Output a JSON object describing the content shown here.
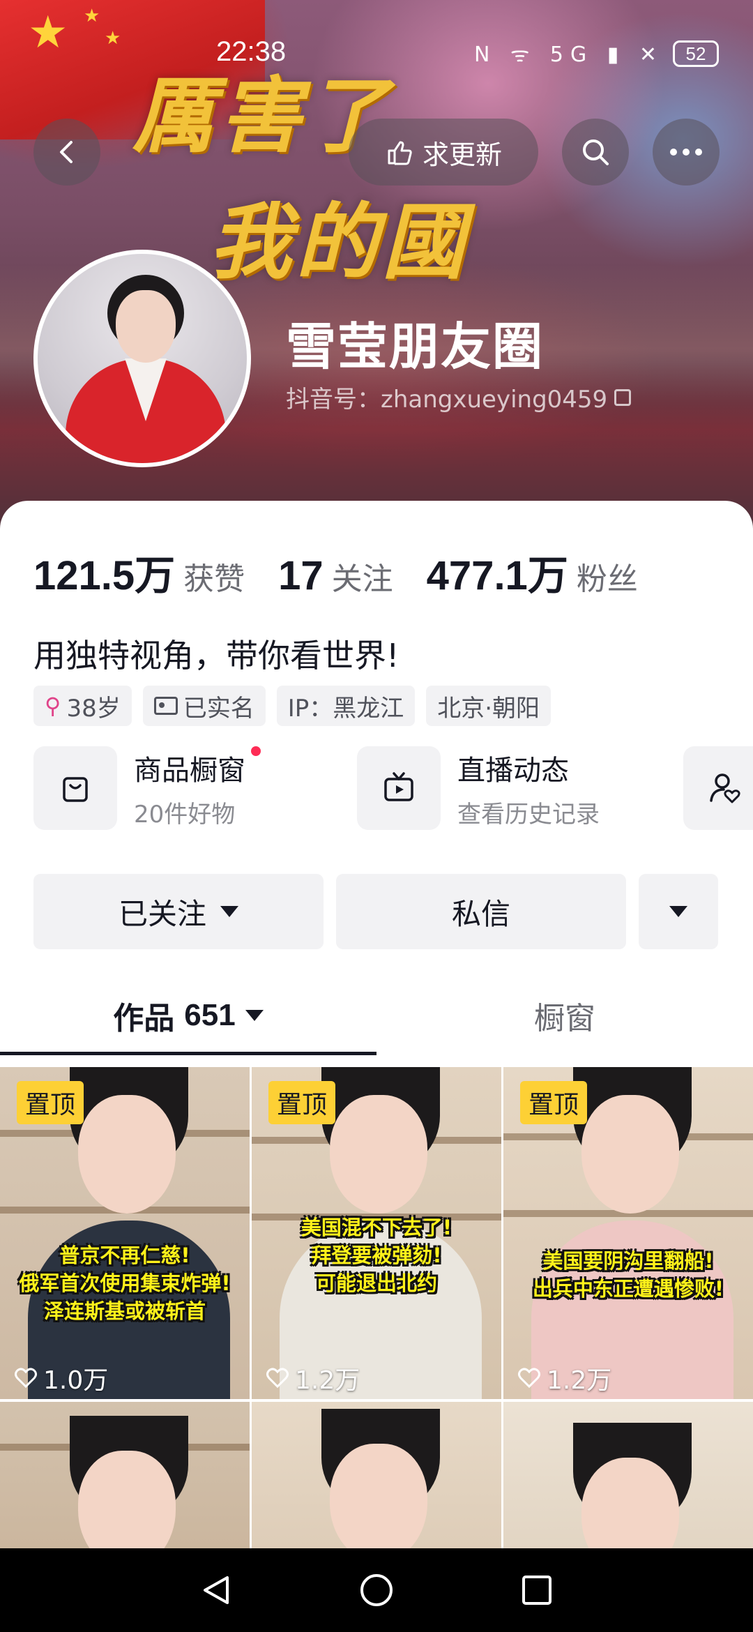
{
  "status_bar": {
    "time": "22:38",
    "signal_icons": "N ᯤ 5G ▮ ✕",
    "battery": "52"
  },
  "banner": {
    "art_line1": "厲害了",
    "art_line2": "我的國"
  },
  "header": {
    "update_button": "求更新",
    "back_icon": "back-arrow-icon",
    "search_icon": "search-icon",
    "more_icon": "more-dots-icon"
  },
  "profile": {
    "name": "雪莹朋友圈",
    "douyin_id": "抖音号：zhangxueying0459",
    "avatar_icon": "avatar-photo"
  },
  "stats": [
    {
      "num": "121.5万",
      "label": "获赞"
    },
    {
      "num": "17",
      "label": "关注"
    },
    {
      "num": "477.1万",
      "label": "粉丝"
    }
  ],
  "bio": "用独特视角，带你看世界!",
  "tags": {
    "age": "38岁",
    "verified": "已实名",
    "ip": "IP：黑龙江",
    "location": "北京·朝阳"
  },
  "features": {
    "shop": {
      "title": "商品橱窗",
      "sub": "20件好物"
    },
    "live": {
      "title": "直播动态",
      "sub": "查看历史记录"
    }
  },
  "actions": {
    "follow": "已关注",
    "message": "私信"
  },
  "tabs": {
    "works_label": "作品",
    "works_count": "651",
    "shop": "橱窗"
  },
  "videos": [
    {
      "pin": "置顶",
      "caption": [
        "普京不再仁慈!",
        "俄军首次使用集束炸弹!",
        "泽连斯基或被斩首"
      ],
      "likes": "1.0万"
    },
    {
      "pin": "置顶",
      "caption": [
        "美国混不下去了!",
        "拜登要被弹劾!",
        "可能退出北约"
      ],
      "likes": "1.2万"
    },
    {
      "pin": "置顶",
      "caption": [
        "美国要阴沟里翻船!",
        "出兵中东正遭遇惨败!"
      ],
      "likes": "1.2万"
    }
  ],
  "colors": {
    "accent_red": "#fe2c55",
    "pin_yellow": "#fdd035",
    "caption_yellow": "#fff21a",
    "banner_gold": "#f2c23a"
  }
}
